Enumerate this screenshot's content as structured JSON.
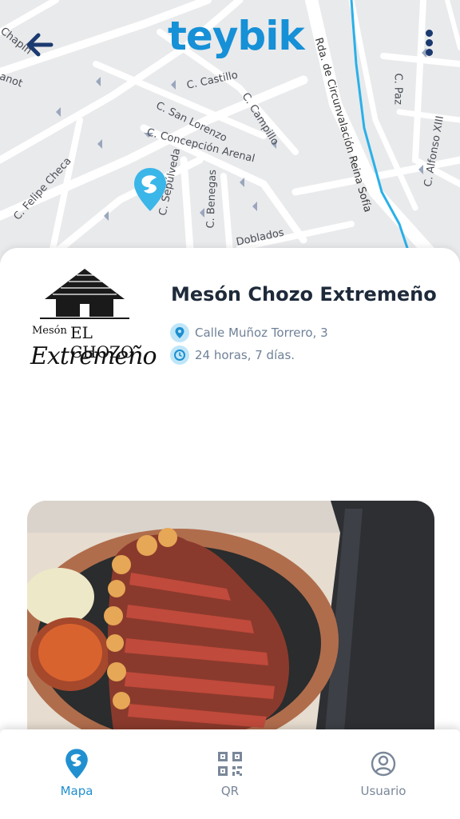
{
  "colors": {
    "brand": "#1690d6",
    "accent": "#3bb6e8",
    "nav_active": "#2190d0",
    "nav_inactive": "#7a8799",
    "title": "#1e2a3a",
    "info_text": "#6f8197",
    "header_icons": "#1b3a70",
    "river": "#2ab0e8"
  },
  "header": {
    "brand": "teybik",
    "back_icon": "arrow-left-icon",
    "menu_icon": "more-vertical-icon"
  },
  "map": {
    "streets": [
      "Chapín",
      "anot",
      "C. Castillo",
      "C. Campillo",
      "C. San Lorenzo",
      "C. Concepción Arenal",
      "C. Sepúlveda",
      "C. Benegas",
      "C. Felipe Checa",
      "Rda. de Circunvalación Reina Sofía",
      "C. Paz",
      "C. Alfonso XIII",
      "Doblados"
    ]
  },
  "place": {
    "name": "Mesón Chozo Extremeño",
    "logo": {
      "line1": "Mesón",
      "line2": "EL CHOZO",
      "line3": "Extremeño"
    },
    "address": "Calle Muñoz Torrero, 3",
    "hours": "24 horas, 7 días.",
    "address_icon": "location-pin-icon",
    "hours_icon": "clock-icon"
  },
  "nav": {
    "items": [
      {
        "label": "Mapa",
        "icon": "map-pin-icon",
        "active": true
      },
      {
        "label": "QR",
        "icon": "qr-code-icon",
        "active": false
      },
      {
        "label": "Usuario",
        "icon": "user-icon",
        "active": false
      }
    ]
  }
}
